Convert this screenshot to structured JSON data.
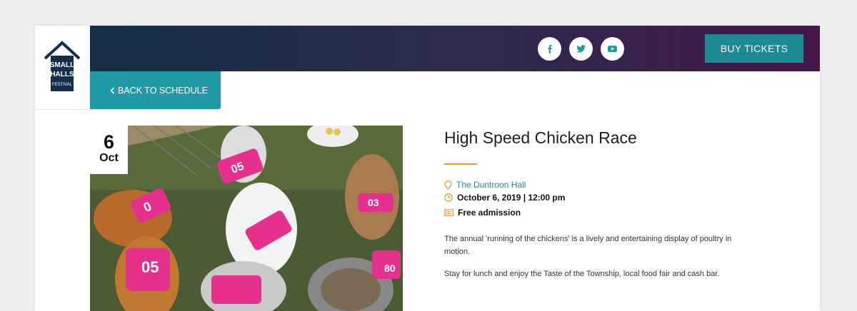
{
  "logo": {
    "line1": "SMALL",
    "line2": "HALLS",
    "line3": "FESTIVAL"
  },
  "header": {
    "social": [
      {
        "icon": "facebook-icon",
        "glyph": "f"
      },
      {
        "icon": "twitter-icon",
        "glyph": "t"
      },
      {
        "icon": "youtube-icon",
        "glyph": "yt"
      }
    ],
    "buy_label": "BUY TICKETS"
  },
  "back_label": "BACK TO SCHEDULE",
  "event": {
    "day": "6",
    "month": "Oct",
    "title": "High Speed Chicken Race",
    "venue": "The Duntroon Hall",
    "datetime": "October 6, 2019 | 12:00 pm",
    "admission": "Free admission",
    "description": [
      "The annual 'running of the chickens' is a lively and entertaining display of poultry in motion.",
      "Stay for lunch and enjoy the Taste of the Township, local food fair and cash bar."
    ],
    "photo_bibs": [
      "05",
      "05",
      "0",
      "03",
      "80"
    ]
  },
  "colors": {
    "accent": "#1f9aa6",
    "buy": "#1c8a94",
    "venue_text": "#1f8e99",
    "icon_orange": "#e59a3c",
    "header_start": "#152e4b",
    "header_end": "#45174a",
    "bib_pink": "#e6308e"
  }
}
